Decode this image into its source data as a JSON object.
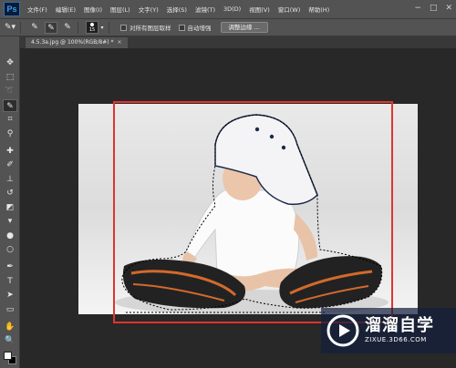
{
  "app": {
    "logo": "Ps"
  },
  "menu": [
    "文件(F)",
    "编辑(E)",
    "图像(I)",
    "图层(L)",
    "文字(Y)",
    "选择(S)",
    "滤镜(T)",
    "3D(D)",
    "视图(V)",
    "窗口(W)",
    "帮助(H)"
  ],
  "window_controls": {
    "minimize": "−",
    "maximize": "□",
    "close": "✕"
  },
  "options": {
    "brush_size": "15",
    "sample_all_layers": "对所有图层取样",
    "auto_enhance": "自动增强",
    "refine_edge": "调整边缘 ..."
  },
  "document": {
    "tab_title": "4.5.3a.jpg @ 100%(RGB/8#) *",
    "close": "×"
  },
  "tools": [
    {
      "name": "move-tool",
      "icon": "move-icon",
      "glyph": "✥"
    },
    {
      "name": "marquee-tool",
      "icon": "marquee-icon",
      "glyph": "⬚"
    },
    {
      "name": "lasso-tool",
      "icon": "lasso-icon",
      "glyph": "➰"
    },
    {
      "name": "quick-selection-tool",
      "icon": "quick-selection-icon",
      "glyph": "✎"
    },
    {
      "name": "crop-tool",
      "icon": "crop-icon",
      "glyph": "⌗"
    },
    {
      "name": "eyedropper-tool",
      "icon": "eyedropper-icon",
      "glyph": "⚲"
    },
    {
      "name": "healing-brush-tool",
      "icon": "bandage-icon",
      "glyph": "✚"
    },
    {
      "name": "brush-tool",
      "icon": "brush-icon",
      "glyph": "✐"
    },
    {
      "name": "clone-stamp-tool",
      "icon": "stamp-icon",
      "glyph": "⊥"
    },
    {
      "name": "history-brush-tool",
      "icon": "history-brush-icon",
      "glyph": "↺"
    },
    {
      "name": "eraser-tool",
      "icon": "eraser-icon",
      "glyph": "◩"
    },
    {
      "name": "paint-bucket-tool",
      "icon": "bucket-icon",
      "glyph": "▾"
    },
    {
      "name": "blur-tool",
      "icon": "blur-drop-icon",
      "glyph": "●"
    },
    {
      "name": "dodge-tool",
      "icon": "dodge-icon",
      "glyph": "○"
    },
    {
      "name": "pen-tool",
      "icon": "pen-icon",
      "glyph": "✒"
    },
    {
      "name": "type-tool",
      "icon": "type-icon",
      "glyph": "T"
    },
    {
      "name": "path-selection-tool",
      "icon": "arrow-icon",
      "glyph": "➤"
    },
    {
      "name": "shape-tool",
      "icon": "rectangle-icon",
      "glyph": "▭"
    },
    {
      "name": "hand-tool",
      "icon": "hand-icon",
      "glyph": "✋"
    },
    {
      "name": "zoom-tool",
      "icon": "magnifier-icon",
      "glyph": "🔍"
    }
  ],
  "colors": {
    "foreground": "#ffffff",
    "background": "#000000",
    "selection_box": "#e0342d"
  },
  "watermark": {
    "title": "溜溜自学",
    "url": "ZIXUE.3D66.COM"
  }
}
